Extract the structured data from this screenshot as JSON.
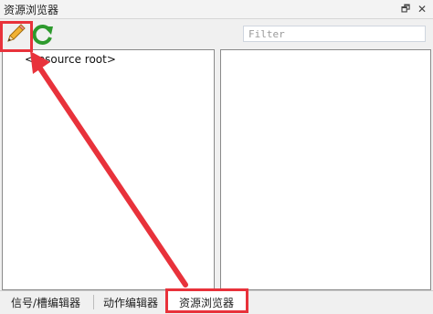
{
  "window": {
    "title": "资源浏览器",
    "controls": [
      "restore-icon",
      "close-icon"
    ],
    "restore_glyph": "🗗",
    "close_glyph": "✕"
  },
  "toolbar": {
    "buttons": [
      {
        "icon": "pencil-icon",
        "action": "edit"
      },
      {
        "icon": "refresh-icon",
        "action": "refresh"
      }
    ]
  },
  "filter": {
    "placeholder": "Filter",
    "value": ""
  },
  "tree": {
    "items": [
      {
        "label": "<resource root>"
      }
    ]
  },
  "tabs": [
    {
      "label": "信号/槽编辑器",
      "active": false
    },
    {
      "label": "动作编辑器",
      "active": false
    },
    {
      "label": "资源浏览器",
      "active": true
    }
  ],
  "annotation": {
    "color": "#e8323b",
    "highlighted": [
      "pencil-icon",
      "tab-资源浏览器"
    ]
  }
}
